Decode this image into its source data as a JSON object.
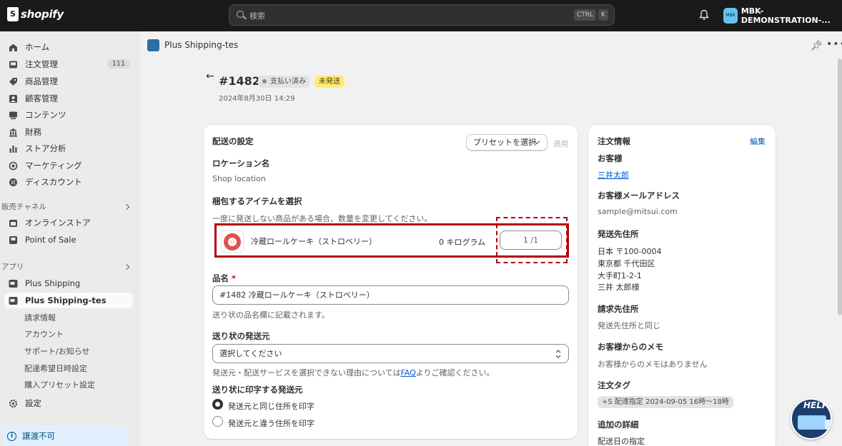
{
  "topbar": {
    "brand": "shopify",
    "search_placeholder": "検索",
    "kbd_ctrl": "CTRL",
    "kbd_k": "K",
    "store_avatar": "MBK",
    "store_name": "MBK-DEMONSTRATION-..."
  },
  "sidebar": {
    "items": [
      {
        "label": "ホーム",
        "icon": "home-icon"
      },
      {
        "label": "注文管理",
        "icon": "inbox-icon",
        "count": "111"
      },
      {
        "label": "商品管理",
        "icon": "tag-icon"
      },
      {
        "label": "顧客管理",
        "icon": "person-icon"
      },
      {
        "label": "コンテンツ",
        "icon": "content-icon"
      },
      {
        "label": "財務",
        "icon": "bank-icon"
      },
      {
        "label": "ストア分析",
        "icon": "bar-chart-icon"
      },
      {
        "label": "マーケティング",
        "icon": "target-icon"
      },
      {
        "label": "ディスカウント",
        "icon": "discount-icon"
      }
    ],
    "sales_channels_label": "販売チャネル",
    "channels": [
      {
        "label": "オンラインストア",
        "icon": "store-icon"
      },
      {
        "label": "Point of Sale",
        "icon": "pos-icon"
      }
    ],
    "apps_label": "アプリ",
    "apps": [
      {
        "label": "Plus Shipping"
      },
      {
        "label": "Plus Shipping-tes"
      }
    ],
    "sub_items": [
      "請求情報",
      "アカウント",
      "サポート/お知らせ",
      "配達希望日時設定",
      "購入プリセット設定"
    ],
    "settings_label": "設定",
    "notice": "譲渡不可"
  },
  "appbar": {
    "title": "Plus Shipping-tes"
  },
  "order": {
    "number": "#1482",
    "payment_status": "支払い済み",
    "fulfillment_status": "未発送",
    "date": "2024年8月30日 14:29"
  },
  "shipping_card": {
    "title": "配送の設定",
    "preset_button": "プリセットを選択",
    "apply_button": "適用",
    "location_label": "ロケーション名",
    "location_value": "Shop location",
    "items_label": "梱包するアイテムを選択",
    "items_help": "一度に発送しない商品がある場合、数量を変更してください。",
    "item_name": "冷蔵ロールケーキ（ストロベリー）",
    "item_weight": "0 キログラム",
    "item_qty": "1 /1",
    "product_name_label": "品名",
    "product_name_value": "#1482 冷蔵ロールケーキ（ストロベリー）",
    "product_name_help": "送り状の品名欄に記載されます。",
    "sender_label": "送り状の発送元",
    "sender_select": "選択してください",
    "sender_help_prefix": "発送元・配送サービスを選択できない理由については",
    "sender_help_link": "FAQ",
    "sender_help_suffix": "よりご確認ください。",
    "print_label": "送り状に印字する発送元",
    "radio_same": "発送元と同じ住所を印字",
    "radio_diff": "発送元と違う住所を印字"
  },
  "order_info": {
    "title": "注文情報",
    "edit": "編集",
    "customer_label": "お客様",
    "customer_name": "三井太郎",
    "email_label": "お客様メールアドレス",
    "email": "sample@mitsui.com",
    "ship_label": "発送先住所",
    "ship_lines": [
      "日本 〒100-0004",
      "東京都 千代田区",
      "大手町1-2-1",
      "三井 太郎様"
    ],
    "billing_label": "請求先住所",
    "billing_value": "発送先住所と同じ",
    "memo_label": "お客様からのメモ",
    "memo_value": "お客様からのメモはありません",
    "tags_label": "注文タグ",
    "tag": "+S 配達指定 2024-09-05 16時〜18時",
    "details_label": "追加の詳細",
    "details_value": "配送日の指定"
  },
  "help_button": "HELP",
  "colors": {
    "topbar": "#1a1a1a",
    "accent_link": "#005bd3",
    "highlight_red": "#b4000a",
    "badge_yellow": "#ffeb78"
  }
}
